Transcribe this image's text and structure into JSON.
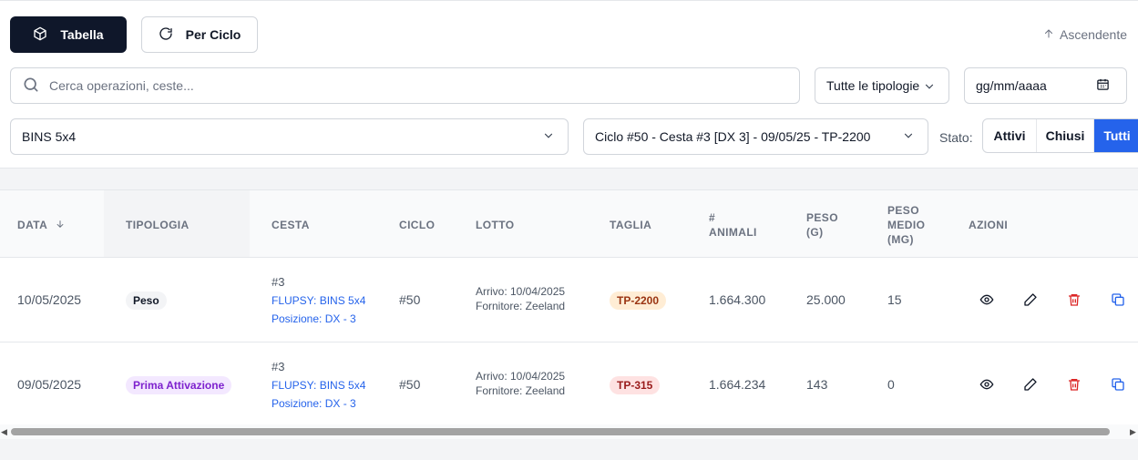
{
  "toolbar": {
    "table_label": "Tabella",
    "cycle_label": "Per Ciclo",
    "sort_label": "Ascendente"
  },
  "search": {
    "placeholder": "Cerca operazioni, ceste..."
  },
  "filters": {
    "type_value": "Tutte le tipologie",
    "date_placeholder": "gg/mm/aaaa",
    "flupsy_value": "BINS 5x4",
    "cycle_value": "Ciclo #50 - Cesta #3 [DX 3] - 09/05/25 - TP-2200",
    "stato_label": "Stato:",
    "stato_options": [
      "Attivi",
      "Chiusi",
      "Tutti"
    ],
    "stato_selected": "Tutti"
  },
  "table": {
    "headers": {
      "data": "Data",
      "tipologia": "Tipologia",
      "cesta": "Cesta",
      "ciclo": "Ciclo",
      "lotto": "Lotto",
      "taglia": "Taglia",
      "animali_1": "#",
      "animali_2": "Animali",
      "peso_1": "Peso",
      "peso_2": "(G)",
      "pm_1": "Peso",
      "pm_2": "Medio",
      "pm_3": "(MG)",
      "azioni": "Azioni"
    },
    "rows": [
      {
        "data": "10/05/2025",
        "tipologia": "Peso",
        "cesta": "#3",
        "flupsy": "FLUPSY: BINS 5x4",
        "posizione": "Posizione: DX - 3",
        "ciclo": "#50",
        "arrivo": "Arrivo: 10/04/2025",
        "fornitore": "Fornitore: Zeeland",
        "taglia": "TP-2200",
        "animali": "1.664.300",
        "peso": "25.000",
        "peso_medio": "15"
      },
      {
        "data": "09/05/2025",
        "tipologia": "Prima Attivazione",
        "cesta": "#3",
        "flupsy": "FLUPSY: BINS 5x4",
        "posizione": "Posizione: DX - 3",
        "ciclo": "#50",
        "arrivo": "Arrivo: 10/04/2025",
        "fornitore": "Fornitore: Zeeland",
        "taglia": "TP-315",
        "animali": "1.664.234",
        "peso": "143",
        "peso_medio": "0"
      }
    ]
  },
  "colors": {
    "primary_dark": "#0f172a",
    "accent_blue": "#2563eb",
    "delete_red": "#dc2626"
  }
}
